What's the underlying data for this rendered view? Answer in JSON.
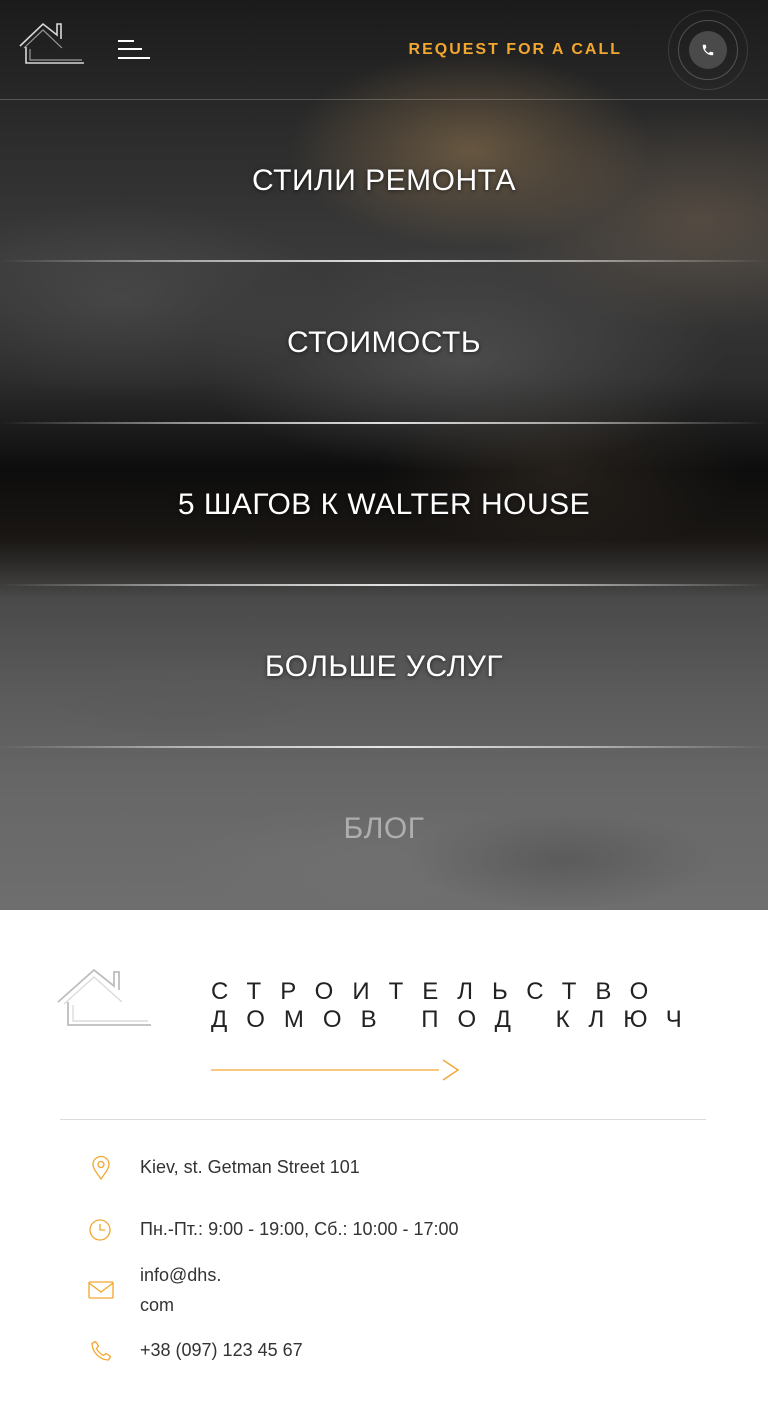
{
  "header": {
    "logo_icon": "house-outline-icon",
    "menu_icon": "hamburger-menu-icon",
    "request_call_label": "REQUEST FOR A CALL",
    "phone_icon": "phone-icon",
    "accent_color": "#f2a730"
  },
  "menu": {
    "items": [
      {
        "label": "СТИЛИ РЕМОНТА"
      },
      {
        "label": "СТОИМОСТЬ"
      },
      {
        "label": "5 ШАГОВ К WALTER HOUSE"
      },
      {
        "label": "БОЛЬШЕ УСЛУГ"
      },
      {
        "label": "БЛОГ"
      }
    ]
  },
  "footer": {
    "logo_icon": "house-outline-icon",
    "tagline_line1": "СТРОИТЕЛЬСТВО",
    "tagline_line2": "ДОМОВ ПОД КЛЮЧ",
    "arrow_icon": "arrow-right-icon",
    "contacts": {
      "address": "Kiev, st. Getman Street 101",
      "hours": "Пн.-Пт.: 9:00 - 19:00, Сб.: 10:00 - 17:00",
      "email_line1": "info@dhs.",
      "email_line2": "com",
      "phone": "+38 (097) 123 45 67"
    }
  }
}
